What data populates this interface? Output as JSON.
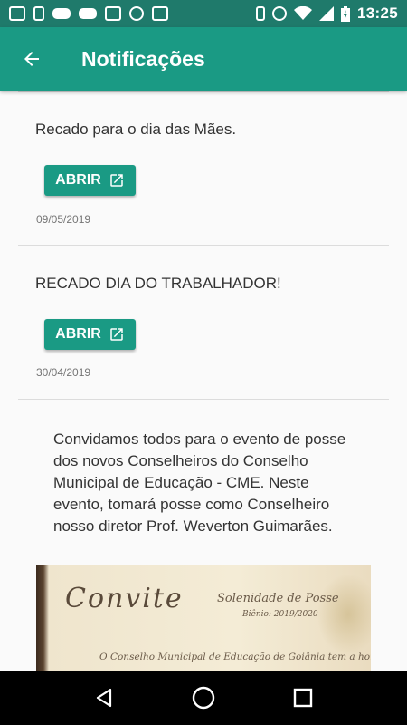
{
  "status_bar": {
    "time": "13:25",
    "left_icons": [
      "chat-icon",
      "phone-icon",
      "tractor-icon",
      "tractor-icon",
      "mail-icon",
      "timer-icon",
      "news-icon"
    ],
    "right_icons": [
      "vibrate-icon",
      "alarm-icon",
      "wifi-icon",
      "signal-icon",
      "battery-charging-icon"
    ]
  },
  "app_bar": {
    "title": "Notificações",
    "color": "#1a9a84"
  },
  "notifications": [
    {
      "text": "Recado para o dia das Mães.",
      "button_label": "ABRIR",
      "date": "09/05/2019"
    },
    {
      "text": "RECADO DIA DO TRABALHADOR!",
      "button_label": "ABRIR",
      "date": "30/04/2019"
    },
    {
      "text": "Convidamos todos para o evento de posse dos novos Conselheiros do Conselho Municipal de Educação - CME. Neste evento, tomará posse como Conselheiro nosso diretor Prof. Weverton Guimarães."
    }
  ],
  "invitation_image": {
    "title": "Convite",
    "subtitle": "Solenidade de Posse",
    "bienio": "Biênio: 2019/2020",
    "line": "O Conselho Municipal de Educação de Goiânia tem a honra"
  },
  "nav_bar": {
    "buttons": [
      "back-triangle-icon",
      "home-circle-icon",
      "recents-square-icon"
    ]
  }
}
